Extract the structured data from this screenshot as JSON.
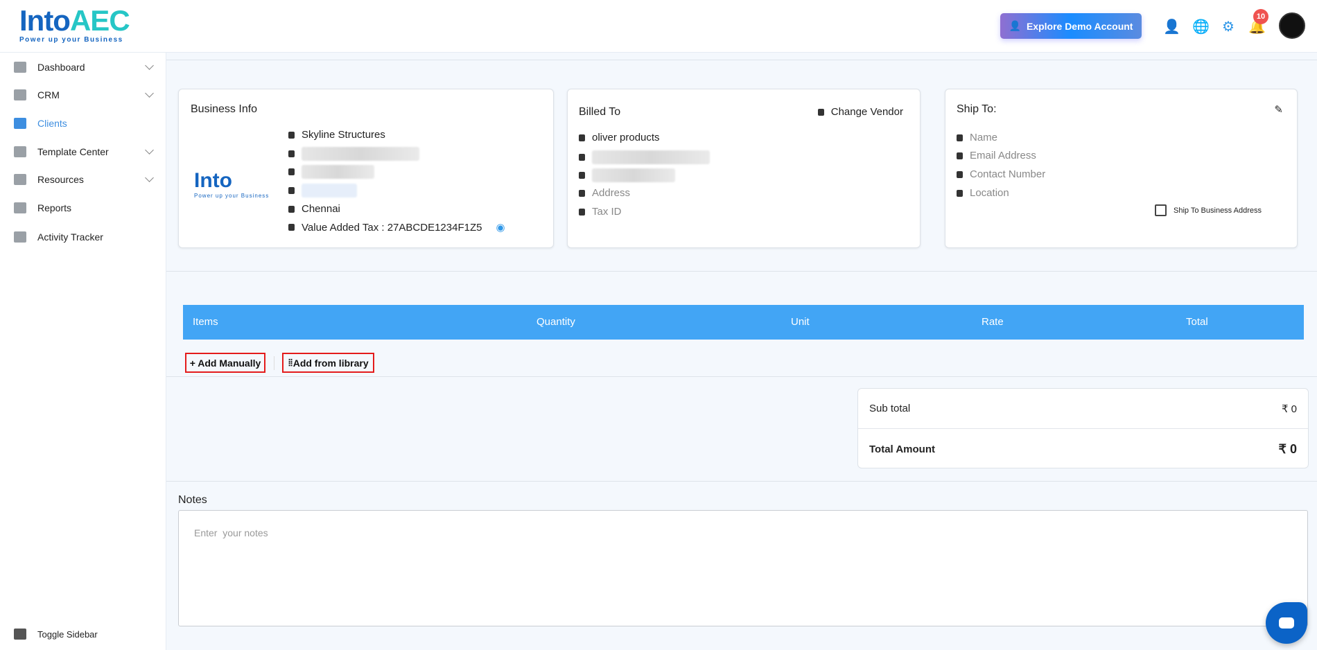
{
  "brand": {
    "name_a": "Into",
    "name_b": "AEC",
    "tagline": "Power up your Business"
  },
  "header": {
    "explore_label": "Explore Demo Account",
    "notification_count": "10",
    "icons": [
      "add-user-icon",
      "globe-icon",
      "gear-icon",
      "bell-icon",
      "avatar"
    ]
  },
  "sidebar": {
    "items": [
      {
        "label": "Dashboard",
        "chevron": true
      },
      {
        "label": "CRM",
        "chevron": true
      },
      {
        "label": "Clients",
        "active": true
      },
      {
        "label": "Template Center",
        "chevron": true
      },
      {
        "label": "Resources",
        "chevron": true
      },
      {
        "label": "Reports"
      },
      {
        "label": "Activity Tracker"
      }
    ],
    "toggle_label": "Toggle Sidebar"
  },
  "business": {
    "title": "Business Info",
    "name": "Skyline Structures",
    "city": "Chennai",
    "vat": "Value Added Tax : 27ABCDE1234F1Z5"
  },
  "billed": {
    "title": "Billed To",
    "change_vendor": "Change Vendor",
    "name": "oliver products",
    "address_placeholder": "Address",
    "tax_placeholder": "Tax ID"
  },
  "ship": {
    "title": "Ship To:",
    "name": "Name",
    "email": "Email Address",
    "contact": "Contact Number",
    "location": "Location",
    "checkbox_label": "Ship To Business Address"
  },
  "table": {
    "columns": [
      "Items",
      "Quantity",
      "Unit",
      "Rate",
      "Total"
    ]
  },
  "actions": {
    "add_manually": "+ Add Manually",
    "add_library": "Add from library"
  },
  "totals": {
    "subtotal_label": "Sub total",
    "subtotal_value": "₹ 0",
    "total_label": "Total Amount",
    "total_value": "₹ 0"
  },
  "notes": {
    "label": "Notes",
    "placeholder": "Enter  your notes"
  },
  "colors": {
    "accent": "#42a5f5",
    "active": "#3d8ee0",
    "chat": "#0b63c7"
  }
}
